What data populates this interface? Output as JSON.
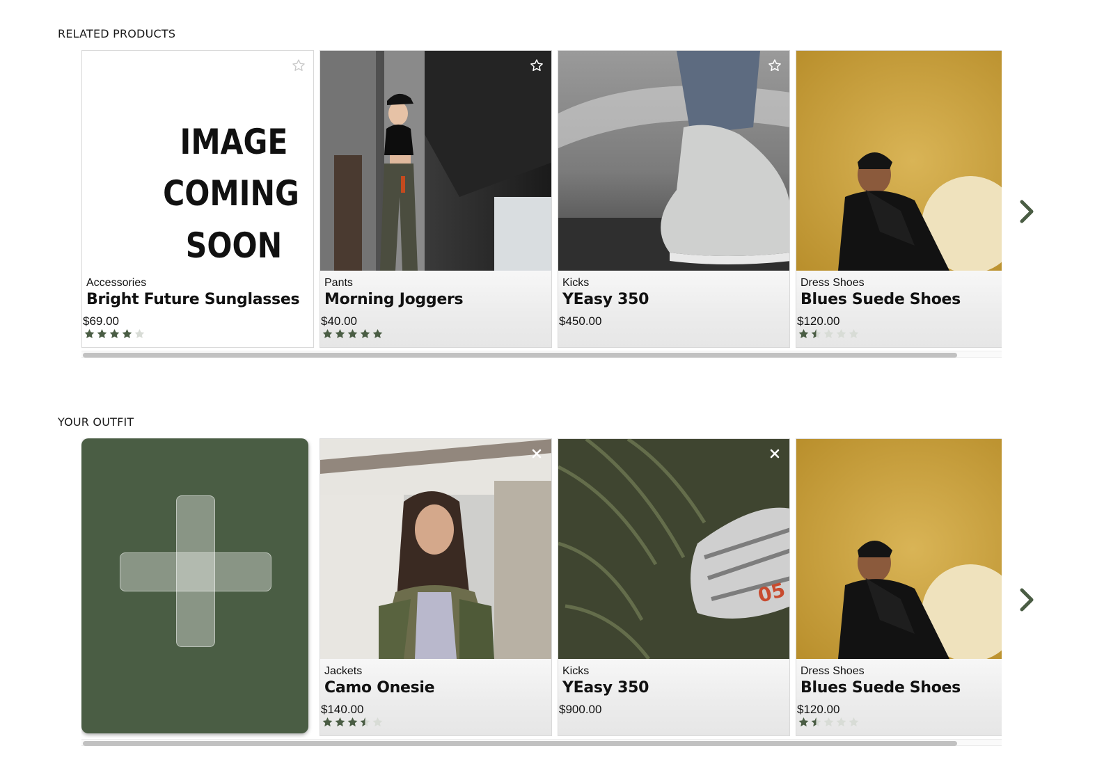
{
  "related": {
    "title": "RELATED PRODUCTS",
    "cards": [
      {
        "category": "Accessories",
        "name": "Bright Future Sunglasses",
        "price": "$69.00",
        "rating": 4,
        "image": "placeholder-image",
        "placeholder_lines": [
          "IMAGE",
          "COMING",
          "SOON"
        ]
      },
      {
        "category": "Pants",
        "name": "Morning Joggers",
        "price": "$40.00",
        "rating": 5,
        "image": "woman-in-black-cap-photo"
      },
      {
        "category": "Kicks",
        "name": "YEasy 350",
        "price": "$450.00",
        "rating": null,
        "image": "grey-sneaker-photo"
      },
      {
        "category": "Dress Shoes",
        "name": "Blues Suede Shoes",
        "price": "$120.00",
        "rating": 1.5,
        "image": "man-on-yellow-fur-photo"
      }
    ],
    "action_icon": "star-outline-icon",
    "next_icon": "chevron-right-icon",
    "scroll_fraction": 0.95
  },
  "outfit": {
    "title": "YOUR OUTFIT",
    "add_icon": "plus-icon",
    "cards": [
      {
        "category": "Jackets",
        "name": "Camo Onesie",
        "price": "$140.00",
        "rating": 3.5,
        "image": "woman-in-camo-jacket-photo"
      },
      {
        "category": "Kicks",
        "name": "YEasy 350",
        "price": "$900.00",
        "rating": null,
        "image": "zebra-sneaker-on-fern-photo"
      },
      {
        "category": "Dress Shoes",
        "name": "Blues Suede Shoes",
        "price": "$120.00",
        "rating": 1.5,
        "image": "man-on-yellow-fur-photo"
      }
    ],
    "action_icon": "close-icon",
    "next_icon": "chevron-right-icon",
    "scroll_fraction": 0.95
  },
  "colors": {
    "accent": "#4a5d44",
    "star_filled": "#4a5d44",
    "star_empty": "#d8dcd6"
  }
}
